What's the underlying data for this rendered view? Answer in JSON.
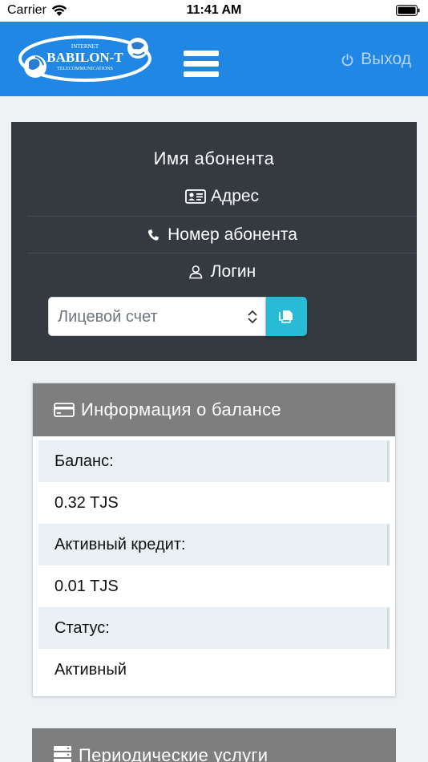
{
  "status_bar": {
    "carrier": "Carrier",
    "time": "11:41 AM"
  },
  "navbar": {
    "logo": {
      "top_text": "INTERNET",
      "main_text": "BABILON-T",
      "bottom_text": "TELECOMMUNICATIONS"
    },
    "logout_label": "Выход",
    "colors": {
      "background": "#2088e4",
      "logout_text": "#b5d4f1"
    }
  },
  "user_panel": {
    "name": "Имя абонента",
    "address": "Адрес",
    "phone": "Номер абонента",
    "login": "Логин",
    "account_select": {
      "value": "Лицевой счет"
    },
    "icons": {
      "address": "id-card-icon",
      "phone": "phone-icon",
      "login": "user-icon",
      "copy": "copy-icon"
    },
    "colors": {
      "background": "#343a40",
      "copy_button": "#27bbd6"
    }
  },
  "balance_card": {
    "title": "Информация о балансе",
    "icon": "credit-card-icon",
    "rows": [
      {
        "label": "Баланс:",
        "value": "0.32 TJS"
      },
      {
        "label": "Активный кредит:",
        "value": "0.01 TJS"
      },
      {
        "label": "Статус:",
        "value": "Активный"
      }
    ]
  },
  "services_card": {
    "title": "Периодические услуги",
    "icon": "server-icon"
  }
}
